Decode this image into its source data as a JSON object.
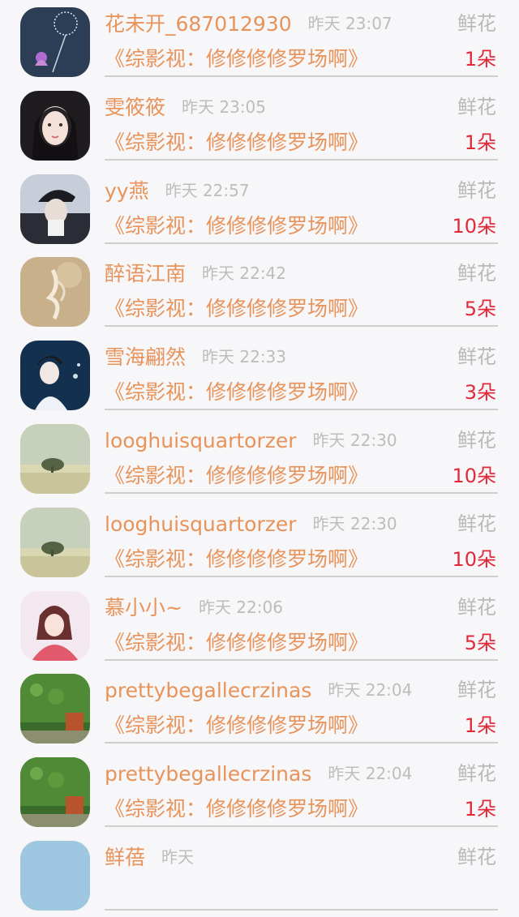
{
  "rows": [
    {
      "name": "花未开_687012930",
      "time": "昨天 23:07",
      "gift": "鲜花",
      "book": "《综影视：修修修修罗场啊》",
      "count": "1朵",
      "avatar": "dandelion-avatar"
    },
    {
      "name": "雯筱筱",
      "time": "昨天 23:05",
      "gift": "鲜花",
      "book": "《综影视：修修修修罗场啊》",
      "count": "1朵",
      "avatar": "girl-portrait-avatar"
    },
    {
      "name": "yy燕",
      "time": "昨天 22:57",
      "gift": "鲜花",
      "book": "《综影视：修修修修罗场啊》",
      "count": "10朵",
      "avatar": "boy-cap-avatar"
    },
    {
      "name": "醉语江南",
      "time": "昨天 22:42",
      "gift": "鲜花",
      "book": "《综影视：修修修修罗场啊》",
      "count": "5朵",
      "avatar": "ink-art-avatar"
    },
    {
      "name": "雪海翩然",
      "time": "昨天 22:33",
      "gift": "鲜花",
      "book": "《综影视：修修修修罗场啊》",
      "count": "3朵",
      "avatar": "ancient-man-avatar"
    },
    {
      "name": "looghuisquartorzer",
      "time": "昨天 22:30",
      "gift": "鲜花",
      "book": "《综影视：修修修修罗场啊》",
      "count": "10朵",
      "avatar": "misty-tree-avatar"
    },
    {
      "name": "looghuisquartorzer",
      "time": "昨天 22:30",
      "gift": "鲜花",
      "book": "《综影视：修修修修罗场啊》",
      "count": "10朵",
      "avatar": "misty-tree-avatar"
    },
    {
      "name": "慕小小~",
      "time": "昨天 22:06",
      "gift": "鲜花",
      "book": "《综影视：修修修修罗场啊》",
      "count": "5朵",
      "avatar": "anime-girl-avatar"
    },
    {
      "name": "prettybegallecrzinas",
      "time": "昨天 22:04",
      "gift": "鲜花",
      "book": "《综影视：修修修修罗场啊》",
      "count": "1朵",
      "avatar": "ivy-house-avatar"
    },
    {
      "name": "prettybegallecrzinas",
      "time": "昨天 22:04",
      "gift": "鲜花",
      "book": "《综影视：修修修修罗场啊》",
      "count": "1朵",
      "avatar": "ivy-house-avatar"
    },
    {
      "name": "鲜蓓",
      "time": "昨天",
      "gift": "鲜花",
      "book": "",
      "count": "",
      "avatar": "partial-avatar"
    }
  ],
  "colors": {
    "name": "#e8935a",
    "time": "#bdbdbd",
    "gift": "#b9b9b9",
    "count": "#e02a3a",
    "divider": "#cfcfcf",
    "background": "#f7f6f8"
  }
}
